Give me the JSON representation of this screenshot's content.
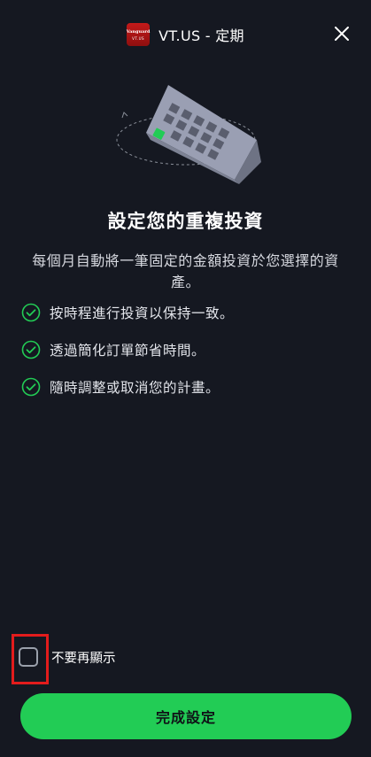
{
  "header": {
    "logo_line1": "Vanguard",
    "logo_line2": "VT.US",
    "title": "VT.US - 定期",
    "close_icon": "close-icon"
  },
  "hero": {
    "icon": "calendar-illustration",
    "highlight_color": "#22cc55"
  },
  "heading": "設定您的重複投資",
  "description": "每個月自動將一筆固定的金額投資於您選擇的資產。",
  "benefits": [
    {
      "icon": "check-circle-icon",
      "text": "按時程進行投資以保持一致。"
    },
    {
      "icon": "check-circle-icon",
      "text": "透過簡化訂單節省時間。"
    },
    {
      "icon": "check-circle-icon",
      "text": "隨時調整或取消您的計畫。"
    }
  ],
  "dont_show_again": {
    "label": "不要再顯示",
    "checked": false
  },
  "cta": {
    "label": "完成設定",
    "color": "#22cc55"
  },
  "colors": {
    "background": "#151821",
    "accent": "#22cc55",
    "highlight_box": "#e31c1c"
  }
}
